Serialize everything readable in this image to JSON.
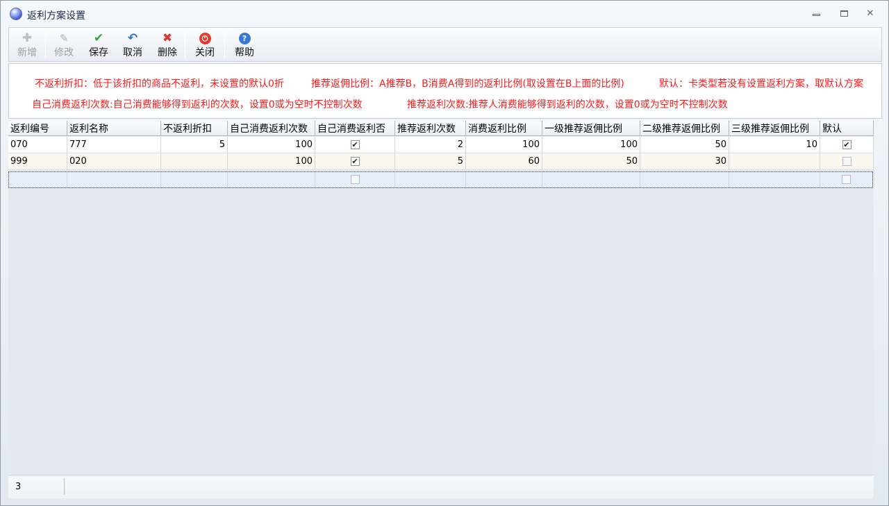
{
  "window": {
    "title": "返利方案设置"
  },
  "toolbar": {
    "buttons": [
      {
        "label": "新增",
        "icon": "plus-icon",
        "enabled": false
      },
      {
        "label": "修改",
        "icon": "edit-icon",
        "enabled": false
      },
      {
        "label": "保存",
        "icon": "check-icon",
        "enabled": true
      },
      {
        "label": "取消",
        "icon": "undo-icon",
        "enabled": true
      },
      {
        "label": "删除",
        "icon": "delete-icon",
        "enabled": true
      },
      {
        "label": "关闭",
        "icon": "power-icon",
        "enabled": true
      },
      {
        "label": "帮助",
        "icon": "help-icon",
        "enabled": true
      }
    ]
  },
  "notes": {
    "line1_a": "不返利折扣：低于该折扣的商品不返利，未设置的默认0折",
    "line1_b": "推荐返佣比例：A推荐B，B消费A得到的返利比例(取设置在B上面的比例)",
    "line1_c": "默认：卡类型若没有设置返利方案，取默认方案",
    "line2_a": "自己消费返利次数:自己消费能够得到返利的次数，设置0或为空时不控制次数",
    "line2_b": "推荐返利次数:推荐人消费能够得到返利的次数，设置0或为空时不控制次数",
    "color": "#ff1a1a"
  },
  "grid": {
    "columns": [
      "返利编号",
      "返利名称",
      "不返利折扣",
      "自己消费返利次数",
      "自己消费返利否",
      "推荐返利次数",
      "消费返利比例",
      "一级推荐返佣比例",
      "二级推荐返佣比例",
      "三级推荐返佣比例",
      "默认"
    ],
    "rows": [
      {
        "code": "070",
        "name": "777",
        "discount": "5",
        "self_times": "100",
        "self_rebate": true,
        "ref_times": "2",
        "rebate_ratio": "100",
        "lvl1": "100",
        "lvl2": "50",
        "lvl3": "10",
        "default": true
      },
      {
        "code": "999",
        "name": "020",
        "discount": "",
        "self_times": "100",
        "self_rebate": true,
        "ref_times": "5",
        "rebate_ratio": "60",
        "lvl1": "50",
        "lvl2": "30",
        "lvl3": "",
        "default": false
      },
      {
        "code": "",
        "name": "",
        "discount": "",
        "self_times": "",
        "self_rebate": false,
        "ref_times": "",
        "rebate_ratio": "",
        "lvl1": "",
        "lvl2": "",
        "lvl3": "",
        "default": false
      }
    ]
  },
  "status": {
    "count": "3"
  }
}
